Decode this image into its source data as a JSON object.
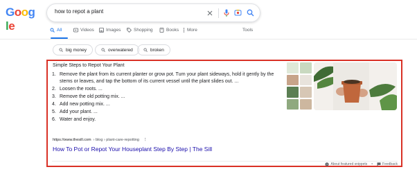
{
  "logo": {
    "letters": [
      {
        "char": "G",
        "color": "#4285f4"
      },
      {
        "char": "o",
        "color": "#ea4335"
      },
      {
        "char": "o",
        "color": "#fbbc05"
      },
      {
        "char": "g",
        "color": "#4285f4"
      },
      {
        "char": "l",
        "color": "#34a853"
      },
      {
        "char": "e",
        "color": "#ea4335"
      }
    ]
  },
  "search": {
    "query": "how to repot a plant"
  },
  "tabs": [
    {
      "label": "All",
      "icon": "search-icon",
      "active": true
    },
    {
      "label": "Videos",
      "icon": "video-icon",
      "active": false
    },
    {
      "label": "Images",
      "icon": "image-icon",
      "active": false
    },
    {
      "label": "Shopping",
      "icon": "shopping-tag-icon",
      "active": false
    },
    {
      "label": "Books",
      "icon": "book-icon",
      "active": false
    },
    {
      "label": "More",
      "icon": "more-vert-icon",
      "active": false
    }
  ],
  "tools_label": "Tools",
  "chips": [
    {
      "label": "big money"
    },
    {
      "label": "overwatered"
    },
    {
      "label": "broken"
    }
  ],
  "snippet": {
    "title": "Simple Steps to Repot Your Plant",
    "steps": [
      "Remove the plant from its current planter or grow pot. Turn your plant sideways, hold it gently by the stems or leaves, and tap the bottom of its current vessel until the plant slides out. ...",
      "Loosen the roots. ...",
      "Remove the old potting mix. ...",
      "Add new potting mix. ...",
      "Add your plant. ...",
      "Water and enjoy."
    ],
    "url_domain": "https://www.thesill.com",
    "url_path": "› blog › plant-care-repotting",
    "link_title": "How To Pot or Repot Your Houseplant Step By Step | The Sill",
    "footer": {
      "about": "About featured snippets",
      "feedback": "Feedback"
    }
  },
  "colors": {
    "accent": "#1a73e8",
    "link": "#1a0dab",
    "highlight_border": "#d93025"
  }
}
